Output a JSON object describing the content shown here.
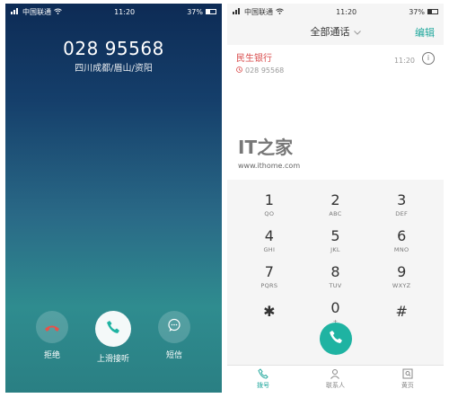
{
  "left": {
    "status": {
      "carrier": "中国联通",
      "time": "11:20",
      "battery": "37%"
    },
    "call": {
      "number": "028 95568",
      "location": "四川成都/眉山/资阳"
    },
    "actions": [
      {
        "label": "拒绝",
        "icon": "decline-phone-icon"
      },
      {
        "label": "上滑接听",
        "icon": "answer-phone-icon"
      },
      {
        "label": "短信",
        "icon": "message-icon"
      }
    ]
  },
  "right": {
    "status": {
      "carrier": "中国联通",
      "time": "11:20",
      "battery": "37%"
    },
    "header": {
      "filter_label": "全部通话",
      "edit_label": "编辑"
    },
    "recent": [
      {
        "name": "民生银行",
        "number": "028 95568",
        "time": "11:20"
      }
    ],
    "watermark": {
      "logo": "IT之家",
      "url": "www.ithome.com"
    },
    "keypad": [
      {
        "digit": "1",
        "letters": "QO"
      },
      {
        "digit": "2",
        "letters": "ABC"
      },
      {
        "digit": "3",
        "letters": "DEF"
      },
      {
        "digit": "4",
        "letters": "GHI"
      },
      {
        "digit": "5",
        "letters": "JKL"
      },
      {
        "digit": "6",
        "letters": "MNO"
      },
      {
        "digit": "7",
        "letters": "PQRS"
      },
      {
        "digit": "8",
        "letters": "TUV"
      },
      {
        "digit": "9",
        "letters": "WXYZ"
      },
      {
        "digit": "✱",
        "letters": ""
      },
      {
        "digit": "0",
        "letters": "+"
      },
      {
        "digit": "#",
        "letters": ""
      }
    ],
    "nav": [
      {
        "label": "拨号",
        "icon": "dialpad-phone-icon",
        "active": true
      },
      {
        "label": "联系人",
        "icon": "contacts-person-icon",
        "active": false
      },
      {
        "label": "黄页",
        "icon": "yellow-pages-icon",
        "active": false
      }
    ],
    "colors": {
      "accent": "#1fa79c",
      "dial_button": "#1fb3a2",
      "missed": "#d94d4d"
    }
  }
}
